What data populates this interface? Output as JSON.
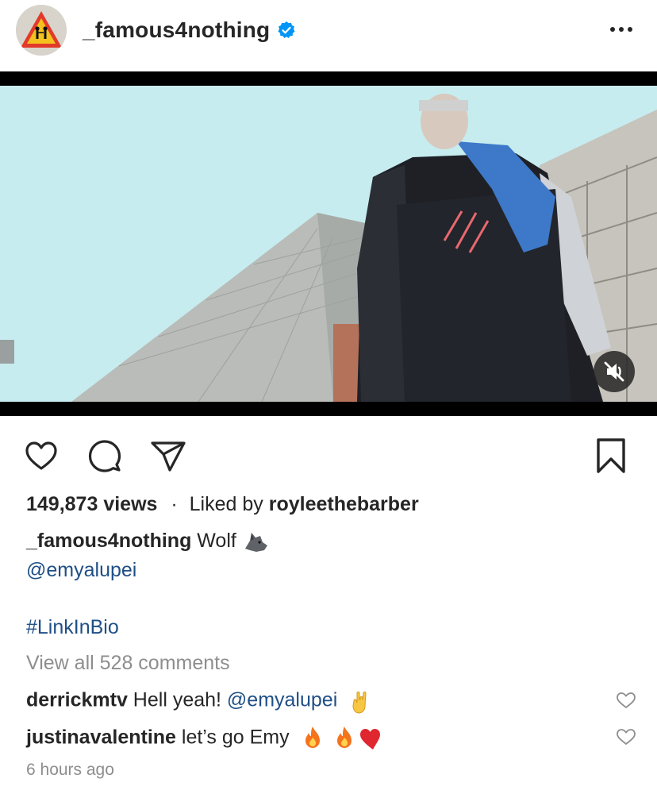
{
  "post": {
    "username": "_famous4nothing",
    "verified": true,
    "more_icon": "ellipsis-icon"
  },
  "video": {
    "muted": true,
    "mute_icon": "speaker-muted-icon"
  },
  "actions": {
    "like_icon": "heart-icon",
    "comment_icon": "comment-icon",
    "share_icon": "paper-plane-icon",
    "save_icon": "bookmark-icon"
  },
  "stats": {
    "views": "149,873 views",
    "separator": "·",
    "liked_by_prefix": "Liked by ",
    "liked_by_user": "royleethebarber"
  },
  "caption": {
    "username": "_famous4nothing",
    "text": " Wolf ",
    "emoji": "wolf-emoji",
    "mention": "@emyalupei",
    "hashtag": "#LinkInBio"
  },
  "comments_link": "View all 528 comments",
  "comments": [
    {
      "username": "derrickmtv",
      "text": " Hell yeah! ",
      "mention": "@emyalupei",
      "emoji": "sign-of-horns-emoji"
    },
    {
      "username": "justinavalentine",
      "text": " let’s go Emy ",
      "emoji": "fire-fire-heart-emoji"
    }
  ],
  "timestamp": "6 hours ago",
  "colors": {
    "verified_blue": "#0095f6",
    "link_blue": "#1f4f86",
    "secondary_grey": "#8e8e8e",
    "sky": "#c6ecef"
  }
}
